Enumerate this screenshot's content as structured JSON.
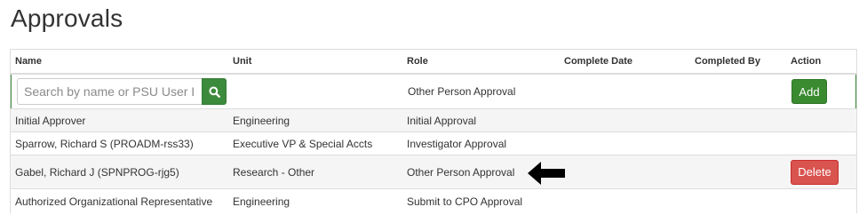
{
  "page_title": "Approvals",
  "table": {
    "headers": {
      "name": "Name",
      "unit": "Unit",
      "role": "Role",
      "complete_date": "Complete Date",
      "completed_by": "Completed By",
      "action": "Action"
    },
    "add_row": {
      "search_placeholder": "Search by name or PSU User ID",
      "search_value": "",
      "role": "Other Person Approval",
      "add_label": "Add"
    },
    "rows": [
      {
        "name": "Initial Approver",
        "unit": "Engineering",
        "role": "Initial Approval",
        "complete_date": "",
        "completed_by": ""
      },
      {
        "name": "Sparrow, Richard S (PROADM-rss33)",
        "unit": "Executive VP & Special Accts",
        "role": "Investigator Approval",
        "complete_date": "",
        "completed_by": ""
      },
      {
        "name": "Gabel, Richard J (SPNPROG-rjg5)",
        "unit": "Research - Other",
        "role": "Other Person Approval",
        "complete_date": "",
        "completed_by": "",
        "action_label": "Delete"
      },
      {
        "name": "Authorized Organizational Representative",
        "unit": "Engineering",
        "role": "Submit to CPO Approval",
        "complete_date": "",
        "completed_by": ""
      }
    ]
  },
  "colors": {
    "add_green": "#3a8a2f",
    "delete_red": "#d9534f",
    "stripe": "#f5f5f5"
  },
  "icons": {
    "search": "search-icon",
    "arrow": "left-arrow-icon"
  }
}
